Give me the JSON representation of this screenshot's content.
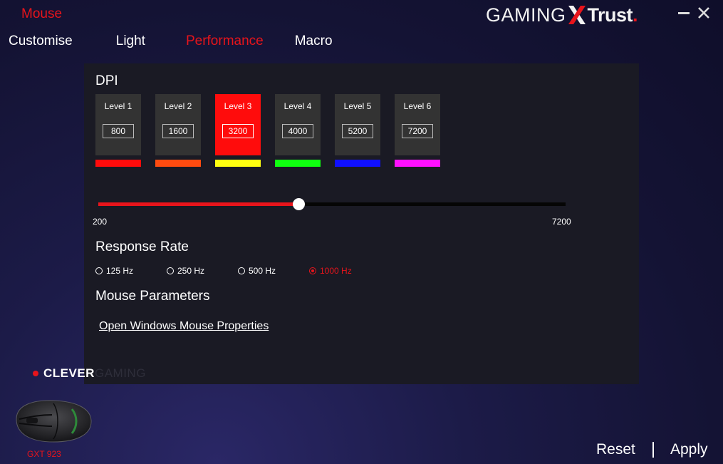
{
  "header": {
    "device_title": "Mouse",
    "brand": {
      "gaming": "GAMING",
      "trust": "Trust",
      "dot": "."
    },
    "window_controls": [
      "minimize-icon",
      "close-icon"
    ]
  },
  "tabs": [
    {
      "label": "Customise",
      "active": false
    },
    {
      "label": "Light",
      "active": false
    },
    {
      "label": "Performance",
      "active": true
    },
    {
      "label": "Macro",
      "active": false
    }
  ],
  "dpi": {
    "title": "DPI",
    "active_level": 3,
    "levels": [
      {
        "label": "Level 1",
        "value": "800",
        "color": "#ff0b0b"
      },
      {
        "label": "Level 2",
        "value": "1600",
        "color": "#ff4b10"
      },
      {
        "label": "Level 3",
        "value": "3200",
        "color": "#ffff10"
      },
      {
        "label": "Level 4",
        "value": "4000",
        "color": "#10ff10"
      },
      {
        "label": "Level 5",
        "value": "5200",
        "color": "#1010ff"
      },
      {
        "label": "Level 6",
        "value": "7200",
        "color": "#ff10ff"
      }
    ],
    "slider": {
      "min_label": "200",
      "max_label": "7200",
      "min": 200,
      "max": 7200,
      "value": 3200
    }
  },
  "response_rate": {
    "title": "Response Rate",
    "options": [
      {
        "label": "125 Hz",
        "checked": false
      },
      {
        "label": "250 Hz",
        "checked": false
      },
      {
        "label": "500 Hz",
        "checked": false
      },
      {
        "label": "1000 Hz",
        "checked": true
      }
    ]
  },
  "mouse_parameters": {
    "title": "Mouse Parameters",
    "link": "Open Windows Mouse Properties"
  },
  "logo": {
    "clever": "CLEVER",
    "gaming": "GAMING"
  },
  "device": {
    "model": "GXT 923"
  },
  "footer": {
    "reset": "Reset",
    "apply": "Apply"
  },
  "colors": {
    "accent": "#e8141b",
    "panel": "#1a1a24",
    "level_box": "#333333"
  }
}
